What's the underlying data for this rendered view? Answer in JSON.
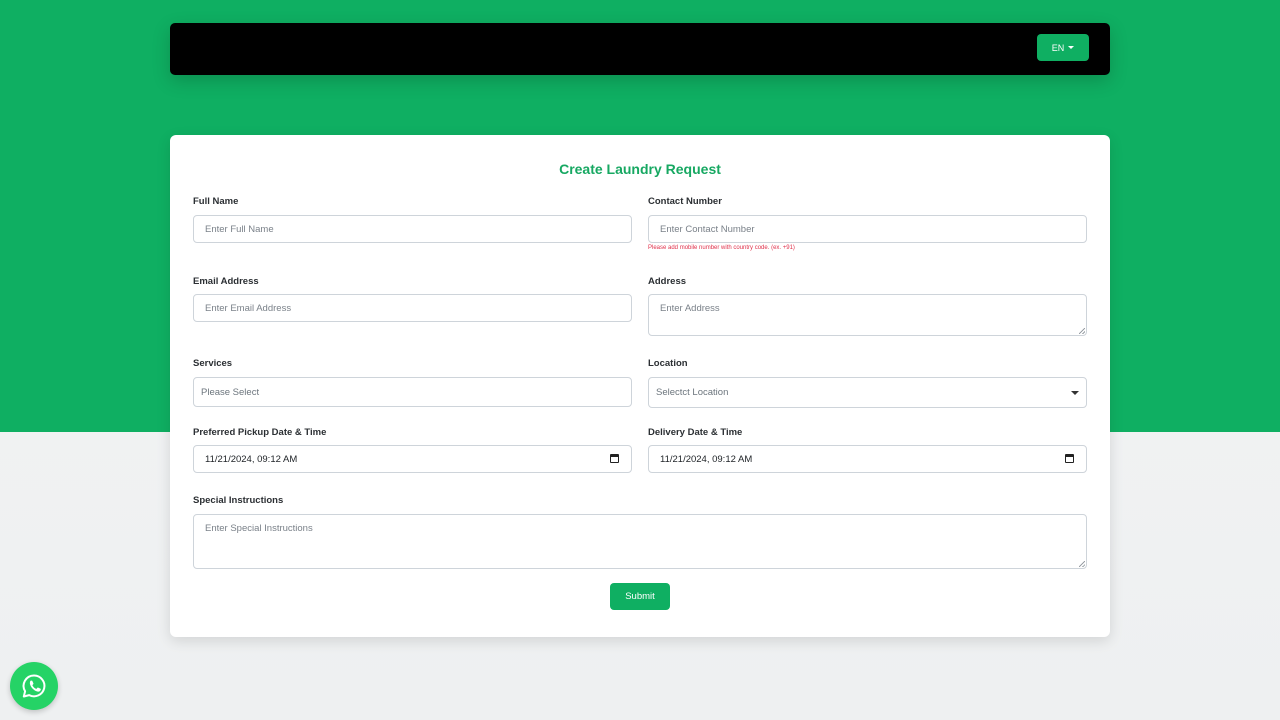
{
  "header": {
    "language_label": "EN"
  },
  "form": {
    "title": "Create Laundry Request",
    "full_name": {
      "label": "Full Name",
      "placeholder": "Enter Full Name"
    },
    "contact_number": {
      "label": "Contact Number",
      "placeholder": "Enter Contact Number",
      "hint": "Please add mobile number with country code. (ex. +91)"
    },
    "email": {
      "label": "Email Address",
      "placeholder": "Enter Email Address"
    },
    "address": {
      "label": "Address",
      "placeholder": "Enter Address"
    },
    "services": {
      "label": "Services",
      "placeholder": "Please Select"
    },
    "location": {
      "label": "Location",
      "placeholder": "Selectct Location"
    },
    "pickup": {
      "label": "Preferred Pickup Date & Time",
      "value": "11/21/2024, 09:12 AM"
    },
    "delivery": {
      "label": "Delivery Date & Time",
      "value": "11/21/2024, 09:12 AM"
    },
    "instructions": {
      "label": "Special Instructions",
      "placeholder": "Enter Special Instructions"
    },
    "submit_label": "Submit"
  },
  "colors": {
    "brand_green": "#0faf62",
    "hint_red": "#e0314b",
    "whatsapp": "#25d366"
  },
  "icons": {
    "language_caret": "caret-down-icon",
    "location_caret": "chevron-down-icon",
    "calendar": "calendar-icon",
    "whatsapp": "whatsapp-icon"
  }
}
